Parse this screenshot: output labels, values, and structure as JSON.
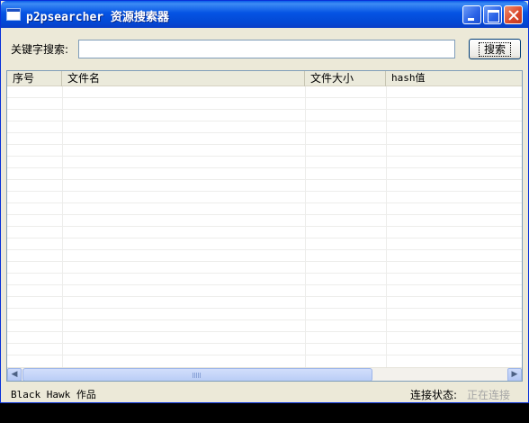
{
  "window": {
    "title": "p2psearcher 资源搜索器"
  },
  "search": {
    "label": "关键字搜索:",
    "value": "",
    "button_label": "搜索"
  },
  "table": {
    "columns": [
      "序号",
      "文件名",
      "文件大小",
      "hash值"
    ],
    "rows": []
  },
  "status": {
    "author": "Black Hawk 作品",
    "connection_label": "连接状态:",
    "connection_value": "正在连接"
  }
}
